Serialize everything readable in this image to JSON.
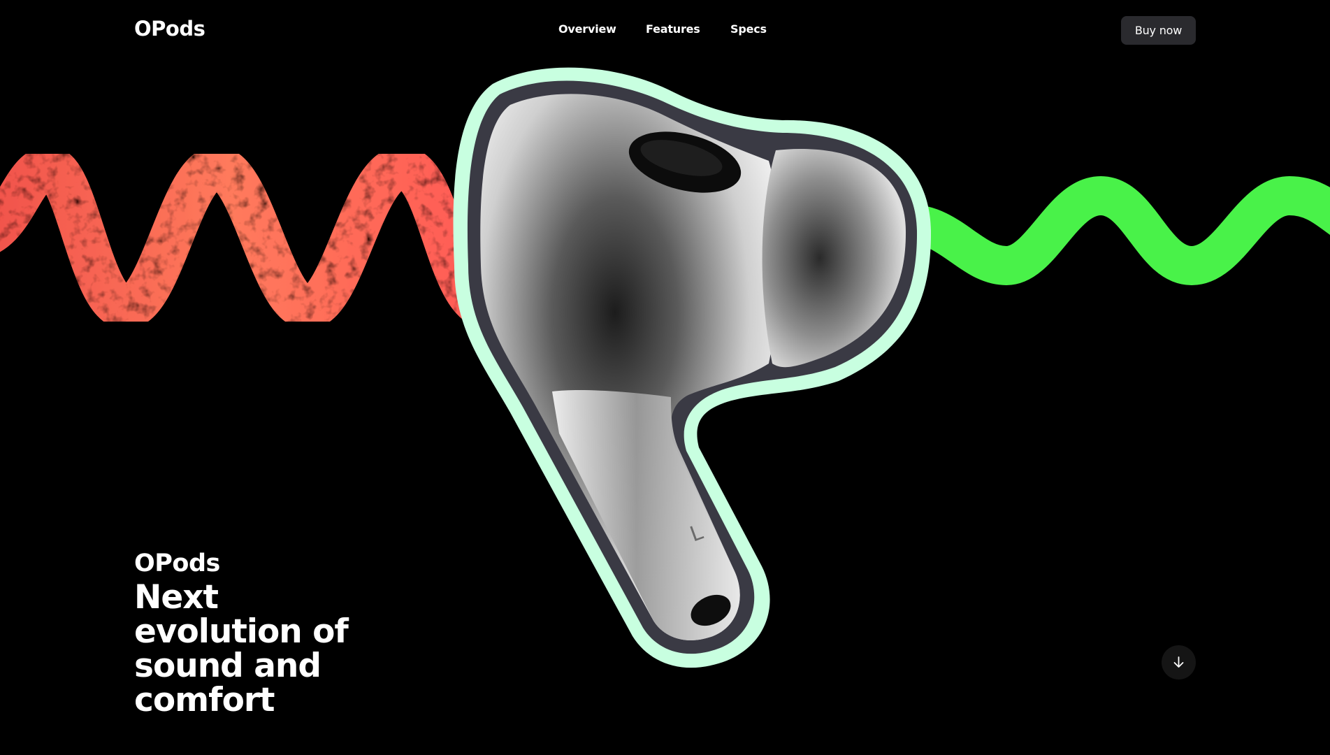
{
  "header": {
    "logo": "OPods",
    "nav": [
      {
        "label": "Overview"
      },
      {
        "label": "Features"
      },
      {
        "label": "Specs"
      }
    ],
    "buy_label": "Buy now"
  },
  "hero": {
    "brand": "OPods",
    "headline": "Next evolution of sound and comfort",
    "earbud_marking": "L"
  },
  "icons": {
    "scroll": "arrow-down-icon"
  },
  "colors": {
    "background": "#000000",
    "wave_left": "#ff6b5a",
    "wave_right": "#4dff4d",
    "earbud_outline": "#c8ffe0",
    "button_bg": "#2a2a2e"
  }
}
